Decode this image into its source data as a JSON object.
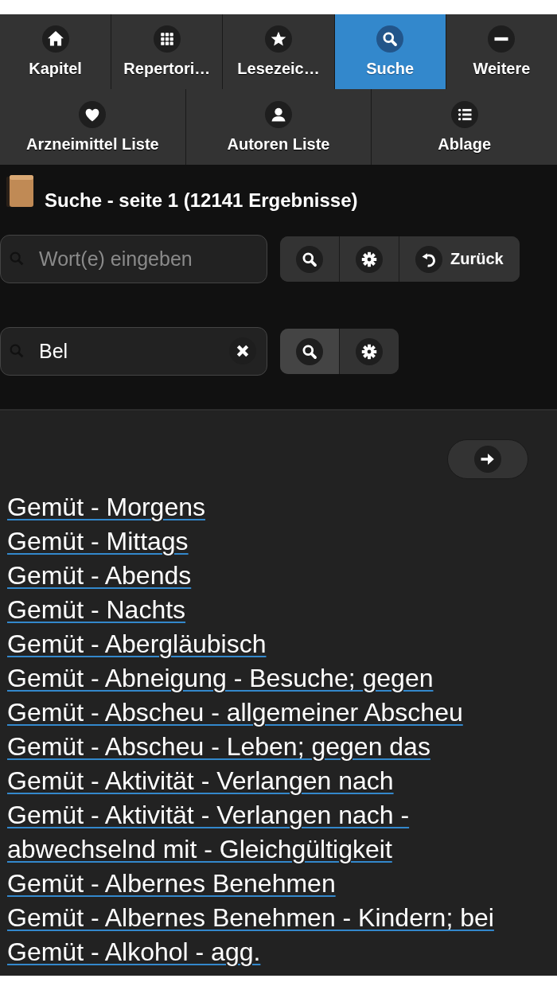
{
  "nav": {
    "tabs": [
      {
        "label": "Kapitel",
        "selected": false
      },
      {
        "label": "Repertori…",
        "selected": false
      },
      {
        "label": "Lesezeic…",
        "selected": false
      },
      {
        "label": "Suche",
        "selected": true
      },
      {
        "label": "Weitere",
        "selected": false
      },
      {
        "label": "Arzneimittel Liste",
        "selected": false
      },
      {
        "label": "Autoren Liste",
        "selected": false
      },
      {
        "label": "Ablage",
        "selected": false
      }
    ]
  },
  "header": {
    "title": "Suche - seite 1 (12141 Ergebnisse)"
  },
  "search_rows": [
    {
      "placeholder": "Wort(e) eingeben",
      "clearable": false,
      "buttons": [
        {
          "kind": "search",
          "active": false
        },
        {
          "kind": "settings",
          "active": false
        },
        {
          "kind": "back",
          "label": "Zurück",
          "active": false
        }
      ]
    },
    {
      "value": "Bel",
      "clearable": true,
      "buttons": [
        {
          "kind": "search",
          "active": true
        },
        {
          "kind": "settings",
          "active": false
        }
      ]
    }
  ],
  "results": {
    "links": [
      "Gemüt - Morgens",
      "Gemüt - Mittags",
      "Gemüt - Abends",
      "Gemüt - Nachts",
      "Gemüt - Abergläubisch",
      "Gemüt - Abneigung - Besuche; gegen",
      "Gemüt - Abscheu - allgemeiner Abscheu",
      "Gemüt - Abscheu - Leben; gegen das",
      "Gemüt - Aktivität - Verlangen nach",
      "Gemüt - Aktivität - Verlangen nach - abwechselnd mit - Gleichgültigkeit",
      "Gemüt - Albernes Benehmen",
      "Gemüt - Albernes Benehmen - Kindern; bei",
      "Gemüt - Alkohol - agg."
    ]
  }
}
